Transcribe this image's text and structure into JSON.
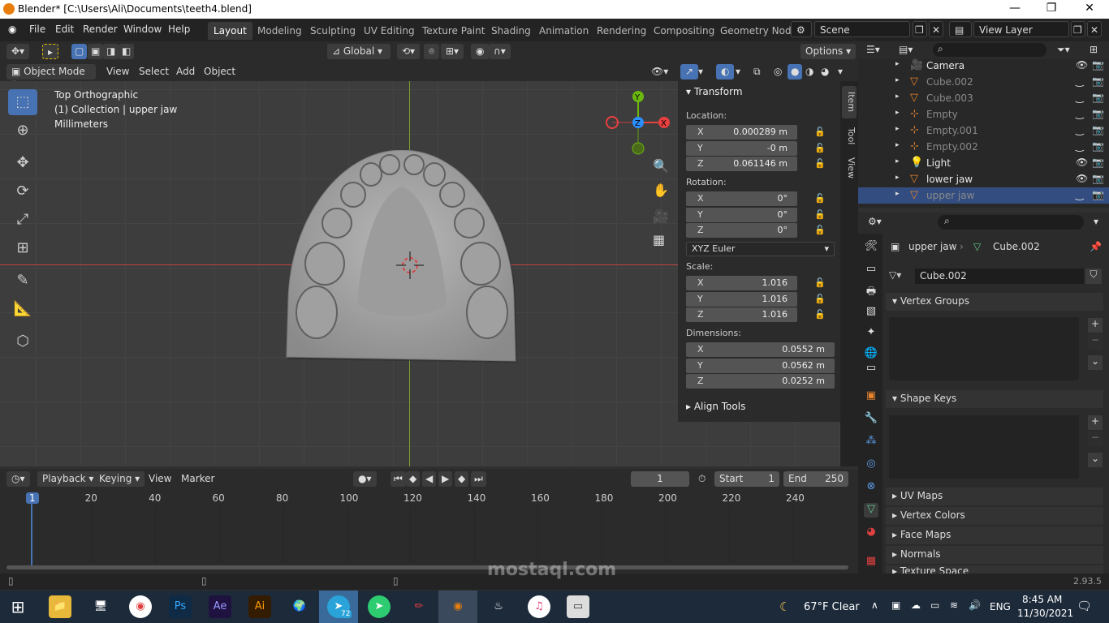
{
  "window": {
    "title": "Blender* [C:\\Users\\Ali\\Documents\\teeth4.blend]"
  },
  "menu": [
    "File",
    "Edit",
    "Render",
    "Window",
    "Help"
  ],
  "workspaces": [
    "Layout",
    "Modeling",
    "Sculpting",
    "UV Editing",
    "Texture Paint",
    "Shading",
    "Animation",
    "Rendering",
    "Compositing",
    "Geometry Nod"
  ],
  "scene": "Scene",
  "view_layer": "View Layer",
  "header": {
    "orientation": "Global",
    "options": "Options",
    "mode": "Object Mode",
    "menus": [
      "View",
      "Select",
      "Add",
      "Object"
    ]
  },
  "viewport": {
    "view_name": "Top Orthographic",
    "collection": "(1) Collection | upper jaw",
    "units": "Millimeters",
    "gizmo": {
      "y": "Y",
      "z": "Z",
      "x": "X"
    }
  },
  "transform": {
    "title": "Transform",
    "location_label": "Location:",
    "rotation_label": "Rotation:",
    "scale_label": "Scale:",
    "dimensions_label": "Dimensions:",
    "location": [
      {
        "a": "X",
        "v": "0.000289 m"
      },
      {
        "a": "Y",
        "v": "-0 m"
      },
      {
        "a": "Z",
        "v": "0.061146 m"
      }
    ],
    "rotation": [
      {
        "a": "X",
        "v": "0°"
      },
      {
        "a": "Y",
        "v": "0°"
      },
      {
        "a": "Z",
        "v": "0°"
      }
    ],
    "rotation_mode": "XYZ Euler",
    "scale": [
      {
        "a": "X",
        "v": "1.016"
      },
      {
        "a": "Y",
        "v": "1.016"
      },
      {
        "a": "Z",
        "v": "1.016"
      }
    ],
    "dimensions": [
      {
        "a": "X",
        "v": "0.0552 m"
      },
      {
        "a": "Y",
        "v": "0.0562 m"
      },
      {
        "a": "Z",
        "v": "0.0252 m"
      }
    ],
    "align_tools": "Align Tools"
  },
  "npanel_tabs": [
    "Item",
    "Tool",
    "View"
  ],
  "outliner": [
    {
      "name": "Camera",
      "dim": false
    },
    {
      "name": "Cube.002",
      "dim": true
    },
    {
      "name": "Cube.003",
      "dim": true
    },
    {
      "name": "Empty",
      "dim": true
    },
    {
      "name": "Empty.001",
      "dim": true
    },
    {
      "name": "Empty.002",
      "dim": true
    },
    {
      "name": "Light",
      "dim": false
    },
    {
      "name": "lower jaw",
      "dim": false
    },
    {
      "name": "upper jaw",
      "dim": true,
      "selected": true
    }
  ],
  "properties": {
    "object": "upper jaw",
    "mesh": "Cube.002",
    "mesh_field": "Cube.002",
    "sections": [
      "Vertex Groups",
      "Shape Keys",
      "UV Maps",
      "Vertex Colors",
      "Face Maps",
      "Normals",
      "Texture Space"
    ]
  },
  "timeline": {
    "menus": [
      "Playback",
      "Keying",
      "View",
      "Marker"
    ],
    "current_frame": "1",
    "start_label": "Start",
    "start": "1",
    "end_label": "End",
    "end": "250",
    "ticks": [
      "1",
      "20",
      "40",
      "60",
      "80",
      "100",
      "120",
      "140",
      "160",
      "180",
      "200",
      "220",
      "240"
    ]
  },
  "status": {
    "version": "2.93.5"
  },
  "taskbar": {
    "weather": "67°F  Clear",
    "lang": "ENG",
    "time": "8:45 AM",
    "date": "11/30/2021",
    "telegram_badge": "72",
    "watermark": "mostaql.com"
  },
  "colors": {
    "accent": "#4772b3",
    "selected_row": "#334d80",
    "x_axis": "#e83f3f",
    "y_axis": "#6bb80e",
    "z_axis": "#2c8fff"
  }
}
